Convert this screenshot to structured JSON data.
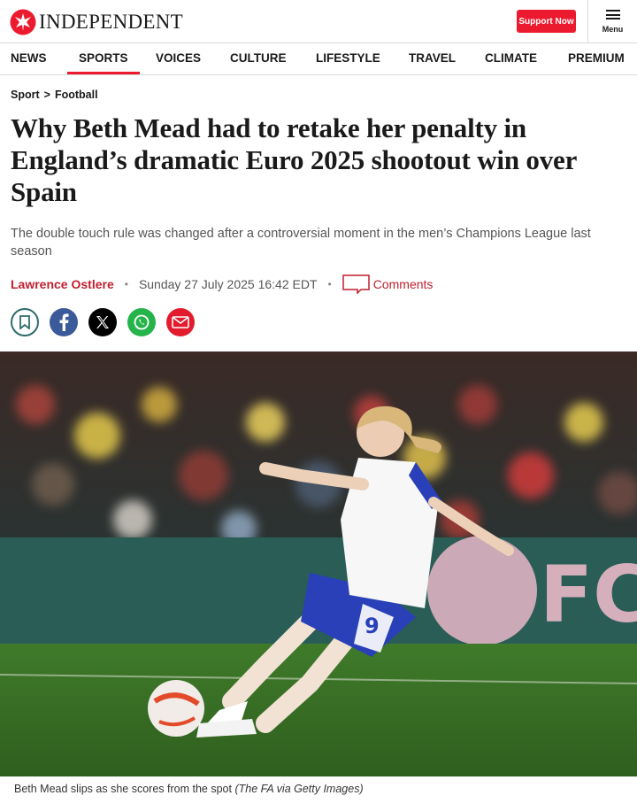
{
  "header": {
    "logo_text": "INDEPENDENT",
    "support_label": "Support Now",
    "menu_label": "Menu",
    "brand_color": "#ec1a2e"
  },
  "nav": {
    "items": [
      {
        "label": "NEWS",
        "active": false
      },
      {
        "label": "SPORTS",
        "active": true
      },
      {
        "label": "VOICES",
        "active": false
      },
      {
        "label": "CULTURE",
        "active": false
      },
      {
        "label": "LIFESTYLE",
        "active": false
      },
      {
        "label": "TRAVEL",
        "active": false
      },
      {
        "label": "CLIMATE",
        "active": false
      },
      {
        "label": "PREMIUM",
        "active": false
      }
    ]
  },
  "article": {
    "breadcrumb": {
      "section": "Sport",
      "separator": ">",
      "subsection": "Football"
    },
    "headline": "Why Beth Mead had to retake her penalty in England’s dramatic Euro 2025 shootout win over Spain",
    "standfirst": "The double touch rule was changed after a controversial moment in the men’s Champions League last season",
    "byline": {
      "author": "Lawrence Ostlere",
      "separator": "•",
      "date": "Sunday 27 July 2025 16:42 EDT",
      "comments_label": "Comments"
    },
    "share_icons": [
      "bookmark-icon",
      "facebook-icon",
      "x-icon",
      "whatsapp-icon",
      "email-icon"
    ],
    "image": {
      "shirt_number": "9",
      "hoarding_text": "FC",
      "caption": "Beth Mead slips as she scores from the spot",
      "credit": "(The FA via Getty Images)"
    }
  }
}
